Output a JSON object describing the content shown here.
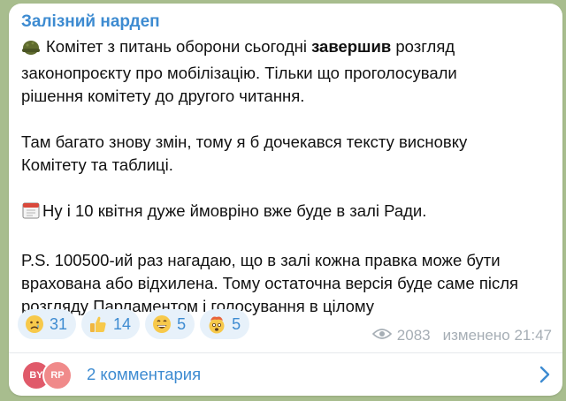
{
  "channel": {
    "name": "Залізний нардеп"
  },
  "post": {
    "p1_line1_before": "Комітет з питань оборони сьогодні ",
    "p1_bold": "завершив",
    "p1_line1_after": " розгляд",
    "p1_line2": "законопроєкту про мобілізацію. Тільки що проголосували",
    "p1_line3": "рішення комітету до другого читання.",
    "p2_line1": "Там багато знову змін, тому я б дочекався тексту висновку",
    "p2_line2": "Комітету та таблиці.",
    "p3_line1": "Ну і 10 квітня дуже ймовріно вже буде в залі Ради.",
    "p4_line1": "P.S. 100500-ий раз нагадаю, що в залі кожна правка може бути",
    "p4_line2": "врахована або відхилена. Тому остаточна версія буде саме після",
    "p4_line3": "розгляду Парламентом і голосування в цілому",
    "icons": {
      "p1": "military-helmet-emoji",
      "p3": "calendar-emoji"
    }
  },
  "reactions": [
    {
      "icon": "crying-face-emoji",
      "count": "31"
    },
    {
      "icon": "thumbs-up-emoji",
      "count": "14"
    },
    {
      "icon": "grinning-face-emoji",
      "count": "5"
    },
    {
      "icon": "exploding-head-emoji",
      "count": "5"
    }
  ],
  "meta": {
    "views": "2083",
    "edited_time": "изменено 21:47",
    "views_icon": "eye-icon"
  },
  "comments": {
    "avatars": [
      {
        "initials": "BY",
        "color": "#e05a6a"
      },
      {
        "initials": "RP",
        "color": "#f08a8a"
      }
    ],
    "label": "2 комментария",
    "chevron_icon": "chevron-right-icon"
  },
  "colors": {
    "accent": "#3d8bd1",
    "background": "#a8bd8e",
    "meta": "#a6aeb5"
  }
}
